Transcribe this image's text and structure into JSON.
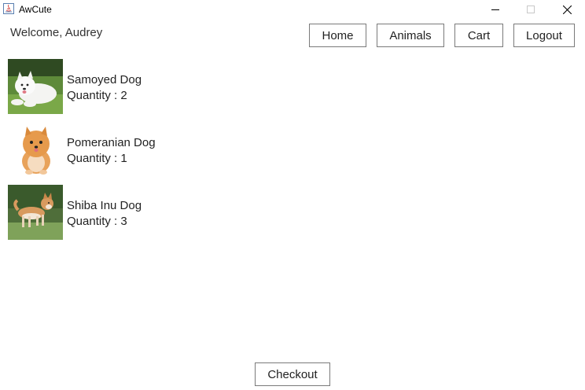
{
  "window": {
    "title": "AwCute",
    "controls": [
      "minimize-icon",
      "maximize-icon",
      "close-icon"
    ]
  },
  "header": {
    "welcome": "Welcome, Audrey",
    "nav": [
      {
        "label": "Home"
      },
      {
        "label": "Animals"
      },
      {
        "label": "Cart"
      },
      {
        "label": "Logout"
      }
    ]
  },
  "cart": {
    "items": [
      {
        "name": "Samoyed Dog",
        "quantity": "Quantity : 2",
        "image": "samoyed-photo"
      },
      {
        "name": "Pomeranian Dog",
        "quantity": "Quantity : 1",
        "image": "pomeranian-photo"
      },
      {
        "name": "Shiba Inu Dog",
        "quantity": "Quantity : 3",
        "image": "shiba-inu-photo"
      }
    ]
  },
  "footer": {
    "checkout_label": "Checkout"
  }
}
